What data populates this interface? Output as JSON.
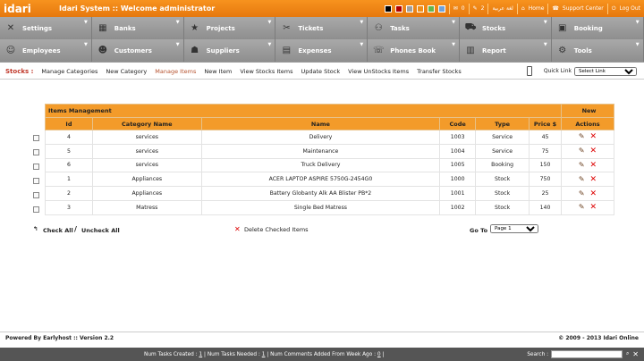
{
  "topbar": {
    "logo": "idari",
    "title": "Idari System :: Welcome administrator",
    "colors": [
      "#000000",
      "#b00000",
      "#9e9e9e",
      "#ef8f1a",
      "#62b64d",
      "#6fa2da"
    ],
    "count1": "0",
    "count2": "2",
    "lang": "لغة عربية",
    "home": "Home",
    "support": "Support Center",
    "logout": "Log Out"
  },
  "nav": {
    "row1": [
      {
        "label": "Settings",
        "icon": "tools-icon"
      },
      {
        "label": "Banks",
        "icon": "bank-icon"
      },
      {
        "label": "Projects",
        "icon": "star-icon"
      },
      {
        "label": "Tickets",
        "icon": "ticket-icon"
      },
      {
        "label": "Tasks",
        "icon": "tasks-icon"
      },
      {
        "label": "Stocks",
        "icon": "truck-icon"
      },
      {
        "label": "Booking",
        "icon": "booking-icon"
      }
    ],
    "row2": [
      {
        "label": "Employees",
        "icon": "employees-icon"
      },
      {
        "label": "Customers",
        "icon": "customers-icon"
      },
      {
        "label": "Suppliers",
        "icon": "suppliers-icon"
      },
      {
        "label": "Expenses",
        "icon": "briefcase-icon"
      },
      {
        "label": "Phones Book",
        "icon": "phone-icon"
      },
      {
        "label": "Report",
        "icon": "chart-icon"
      },
      {
        "label": "Tools",
        "icon": "gear-icon"
      }
    ]
  },
  "subnav": {
    "label": "Stocks :",
    "links": [
      "Manage Categories",
      "New Category",
      "Manage Items",
      "New Item",
      "View Stocks Items",
      "Update Stock",
      "View UnStocks Items",
      "Transfer Stocks"
    ],
    "quick_link": "Quick Link",
    "quick_select": "Select Link"
  },
  "table": {
    "title": "Items Management",
    "new": "New",
    "headers": [
      "Id",
      "Category Name",
      "Name",
      "Code",
      "Type",
      "Price $",
      "Actions"
    ],
    "rows": [
      [
        "4",
        "services",
        "Delivery",
        "1003",
        "Service",
        "45"
      ],
      [
        "5",
        "services",
        "Maintenance",
        "1004",
        "Service",
        "75"
      ],
      [
        "6",
        "services",
        "Truck Delivery",
        "1005",
        "Booking",
        "150"
      ],
      [
        "1",
        "Appliances",
        "ACER LAPTOP ASPIRE 5750G-2454G0",
        "1000",
        "Stock",
        "750"
      ],
      [
        "2",
        "Appliances",
        "Battery Globanty Alk AA Blister PB*2",
        "1001",
        "Stock",
        "25"
      ],
      [
        "3",
        "Matress",
        "Single Bed Matress",
        "1002",
        "Stock",
        "140"
      ]
    ]
  },
  "bulk": {
    "check_all": "Check All",
    "uncheck_all": "Uncheck All",
    "delete_checked": "Delete Checked Items",
    "goto": "Go To",
    "page": "Page 1"
  },
  "footer": {
    "powered": "Powered By Earlyhost :: Version 2.2",
    "copyright": "© 2009 - 2013 Idari Online"
  },
  "bottombar": {
    "item1": "Num Tasks Created :",
    "v1": "1",
    "item2": "Num Tasks Needed :",
    "v2": "1",
    "item3": "Num Comments Added From Week Ago :",
    "v3": "0",
    "search": "Search :"
  }
}
